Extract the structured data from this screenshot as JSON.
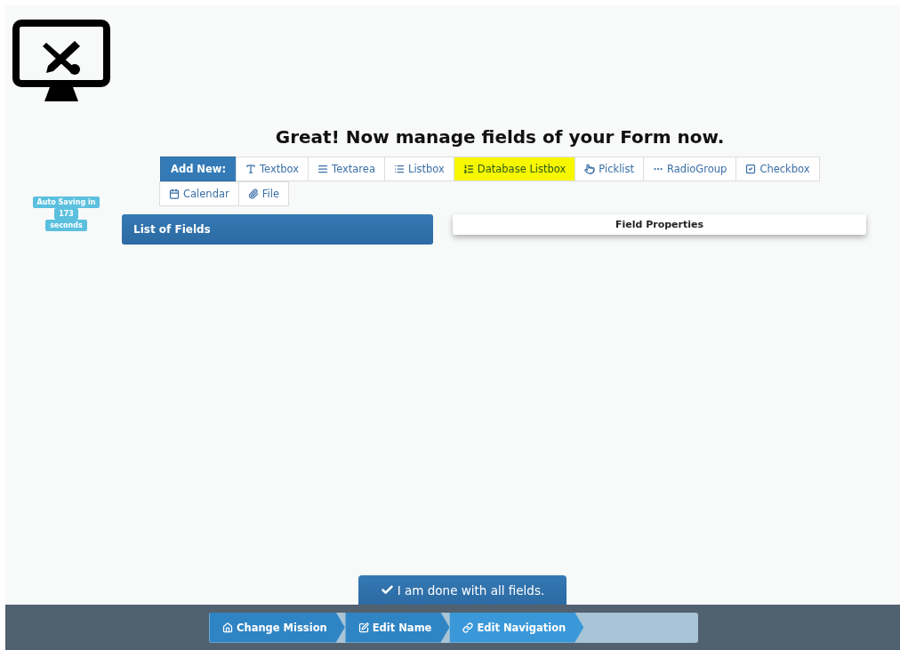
{
  "heading": "Great! Now manage fields of your Form now.",
  "toolbar": {
    "label": "Add New:",
    "items": [
      {
        "kind": "textbox",
        "label": "Textbox",
        "highlighted": false
      },
      {
        "kind": "textarea",
        "label": "Textarea",
        "highlighted": false
      },
      {
        "kind": "listbox",
        "label": "Listbox",
        "highlighted": false
      },
      {
        "kind": "dblistbox",
        "label": "Database Listbox",
        "highlighted": true
      },
      {
        "kind": "picklist",
        "label": "Picklist",
        "highlighted": false
      },
      {
        "kind": "radiogroup",
        "label": "RadioGroup",
        "highlighted": false
      },
      {
        "kind": "checkbox",
        "label": "Checkbox",
        "highlighted": false
      },
      {
        "kind": "calendar",
        "label": "Calendar",
        "highlighted": false
      },
      {
        "kind": "file",
        "label": "File",
        "highlighted": false
      }
    ]
  },
  "autosave": [
    "Auto Saving in",
    "173",
    "seconds"
  ],
  "list_panel": {
    "title": "List of Fields"
  },
  "properties_panel": {
    "title": "Field Properties"
  },
  "done_button": "I am done with all fields.",
  "breadcrumb": [
    {
      "kind": "home",
      "label": "Change Mission",
      "selected": false
    },
    {
      "kind": "edit",
      "label": "Edit Name",
      "selected": false
    },
    {
      "kind": "link",
      "label": "Edit Navigation",
      "selected": true
    }
  ]
}
